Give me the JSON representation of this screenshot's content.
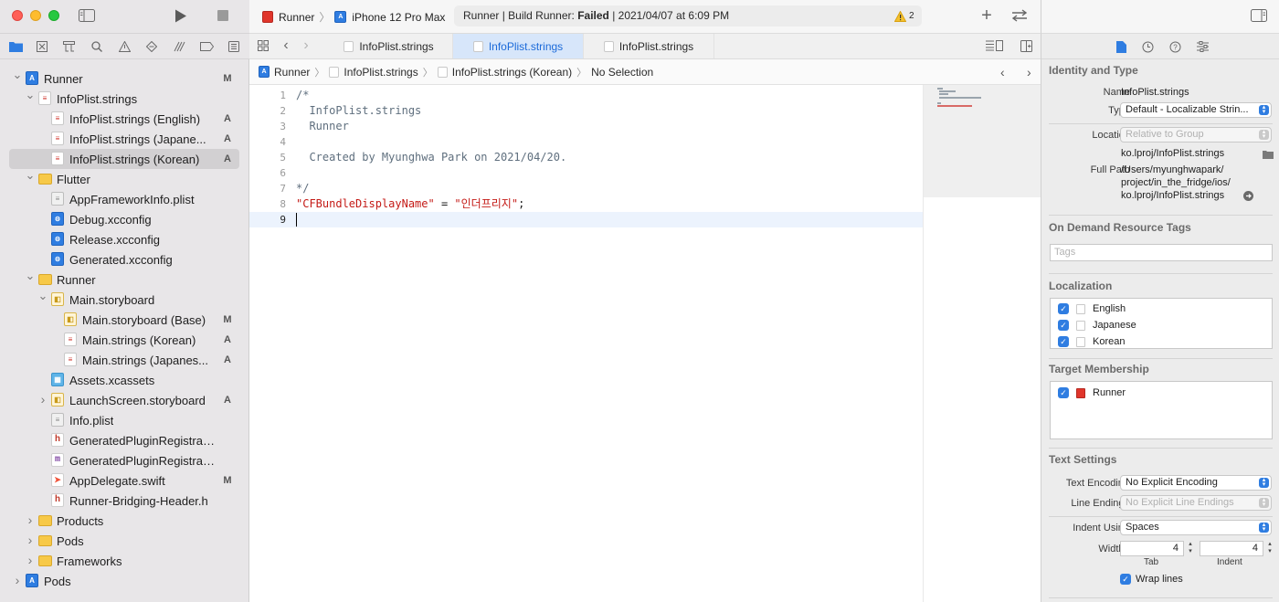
{
  "toolbar": {
    "scheme": "Runner",
    "device": "iPhone 12 Pro Max",
    "status_prefix": "Runner | Build Runner: ",
    "status_result": "Failed",
    "status_time": " | 2021/04/07 at 6:09 PM",
    "warning_count": "2"
  },
  "tabs": [
    {
      "label": "InfoPlist.strings",
      "active": false
    },
    {
      "label": "InfoPlist.strings",
      "active": true
    },
    {
      "label": "InfoPlist.strings",
      "active": false
    }
  ],
  "jump_bar": [
    "Runner",
    "InfoPlist.strings",
    "InfoPlist.strings (Korean)",
    "No Selection"
  ],
  "navigator": [
    {
      "label": "Runner",
      "icon": "project-icon",
      "indent": 0,
      "disclosure": "open",
      "status": "M"
    },
    {
      "label": "InfoPlist.strings",
      "icon": "strings-icon",
      "indent": 1,
      "disclosure": "open",
      "status": ""
    },
    {
      "label": "InfoPlist.strings (English)",
      "icon": "strings-icon",
      "indent": 2,
      "disclosure": "",
      "status": "A"
    },
    {
      "label": "InfoPlist.strings (Japane...",
      "icon": "strings-icon",
      "indent": 2,
      "disclosure": "",
      "status": "A"
    },
    {
      "label": "InfoPlist.strings (Korean)",
      "icon": "strings-icon",
      "indent": 2,
      "disclosure": "",
      "status": "A",
      "selected": true
    },
    {
      "label": "Flutter",
      "icon": "folder-icon",
      "indent": 1,
      "disclosure": "open",
      "status": ""
    },
    {
      "label": "AppFrameworkInfo.plist",
      "icon": "plist-icon",
      "indent": 2,
      "disclosure": "",
      "status": ""
    },
    {
      "label": "Debug.xcconfig",
      "icon": "xcconfig-icon",
      "indent": 2,
      "disclosure": "",
      "status": ""
    },
    {
      "label": "Release.xcconfig",
      "icon": "xcconfig-icon",
      "indent": 2,
      "disclosure": "",
      "status": ""
    },
    {
      "label": "Generated.xcconfig",
      "icon": "xcconfig-icon",
      "indent": 2,
      "disclosure": "",
      "status": ""
    },
    {
      "label": "Runner",
      "icon": "folder-icon",
      "indent": 1,
      "disclosure": "open",
      "status": ""
    },
    {
      "label": "Main.storyboard",
      "icon": "storyboard-icon",
      "indent": 2,
      "disclosure": "open",
      "status": ""
    },
    {
      "label": "Main.storyboard (Base)",
      "icon": "storyboard-icon",
      "indent": 3,
      "disclosure": "",
      "status": "M"
    },
    {
      "label": "Main.strings (Korean)",
      "icon": "strings-icon",
      "indent": 3,
      "disclosure": "",
      "status": "A"
    },
    {
      "label": "Main.strings (Japanes...",
      "icon": "strings-icon",
      "indent": 3,
      "disclosure": "",
      "status": "A"
    },
    {
      "label": "Assets.xcassets",
      "icon": "assets-icon",
      "indent": 2,
      "disclosure": "",
      "status": ""
    },
    {
      "label": "LaunchScreen.storyboard",
      "icon": "storyboard-icon",
      "indent": 2,
      "disclosure": "closed",
      "status": "A"
    },
    {
      "label": "Info.plist",
      "icon": "plist-icon",
      "indent": 2,
      "disclosure": "",
      "status": ""
    },
    {
      "label": "GeneratedPluginRegistrant.h",
      "icon": "header-icon",
      "indent": 2,
      "disclosure": "",
      "status": ""
    },
    {
      "label": "GeneratedPluginRegistrant....",
      "icon": "objc-icon",
      "indent": 2,
      "disclosure": "",
      "status": ""
    },
    {
      "label": "AppDelegate.swift",
      "icon": "swift-icon",
      "indent": 2,
      "disclosure": "",
      "status": "M"
    },
    {
      "label": "Runner-Bridging-Header.h",
      "icon": "header-icon",
      "indent": 2,
      "disclosure": "",
      "status": ""
    },
    {
      "label": "Products",
      "icon": "folder-icon",
      "indent": 1,
      "disclosure": "closed",
      "status": ""
    },
    {
      "label": "Pods",
      "icon": "folder-icon",
      "indent": 1,
      "disclosure": "closed",
      "status": ""
    },
    {
      "label": "Frameworks",
      "icon": "folder-icon",
      "indent": 1,
      "disclosure": "closed",
      "status": ""
    },
    {
      "label": "Pods",
      "icon": "project-icon",
      "indent": 0,
      "disclosure": "closed",
      "status": ""
    }
  ],
  "editor": {
    "lines": [
      {
        "n": "1",
        "parts": [
          {
            "t": "/*",
            "c": "comment"
          }
        ]
      },
      {
        "n": "2",
        "parts": [
          {
            "t": "  InfoPlist.strings",
            "c": "comment"
          }
        ]
      },
      {
        "n": "3",
        "parts": [
          {
            "t": "  Runner",
            "c": "comment"
          }
        ]
      },
      {
        "n": "4",
        "parts": []
      },
      {
        "n": "5",
        "parts": [
          {
            "t": "  Created by Myunghwa Park on 2021/04/20.",
            "c": "comment"
          }
        ]
      },
      {
        "n": "6",
        "parts": []
      },
      {
        "n": "7",
        "parts": [
          {
            "t": "*/",
            "c": "comment"
          }
        ]
      },
      {
        "n": "8",
        "parts": [
          {
            "t": "\"CFBundleDisplayName\"",
            "c": "string"
          },
          {
            "t": " = ",
            "c": "plain"
          },
          {
            "t": "\"인더프리지\"",
            "c": "string"
          },
          {
            "t": ";",
            "c": "plain"
          }
        ]
      },
      {
        "n": "9",
        "parts": [],
        "current": true
      }
    ]
  },
  "inspector": {
    "identity_header": "Identity and Type",
    "name_label": "Name",
    "name_value": "InfoPlist.strings",
    "type_label": "Type",
    "type_value": "Default - Localizable Strin...",
    "location_label": "Location",
    "location_value": "Relative to Group",
    "location_path": "ko.lproj/InfoPlist.strings",
    "fullpath_label": "Full Path",
    "fullpath_1": "/Users/myunghwapark/",
    "fullpath_2": "project/in_the_fridge/ios/",
    "fullpath_3": "ko.lproj/InfoPlist.strings",
    "ondemand_header": "On Demand Resource Tags",
    "tags_placeholder": "Tags",
    "localization_header": "Localization",
    "localizations": [
      "English",
      "Japanese",
      "Korean"
    ],
    "target_header": "Target Membership",
    "targets": [
      "Runner"
    ],
    "text_settings_header": "Text Settings",
    "encoding_label": "Text Encoding",
    "encoding_value": "No Explicit Encoding",
    "line_endings_label": "Line Endings",
    "line_endings_value": "No Explicit Line Endings",
    "indent_using_label": "Indent Using",
    "indent_using_value": "Spaces",
    "widths_label": "Widths",
    "tab_width": "4",
    "indent_width": "4",
    "tab_label": "Tab",
    "indent_label": "Indent",
    "wrap_label": "Wrap lines"
  },
  "colors": {
    "accent": "#2f7de1",
    "failed_status": "#1d1d1d",
    "string_literal": "#c41a16",
    "comment": "#5f6f7e"
  }
}
